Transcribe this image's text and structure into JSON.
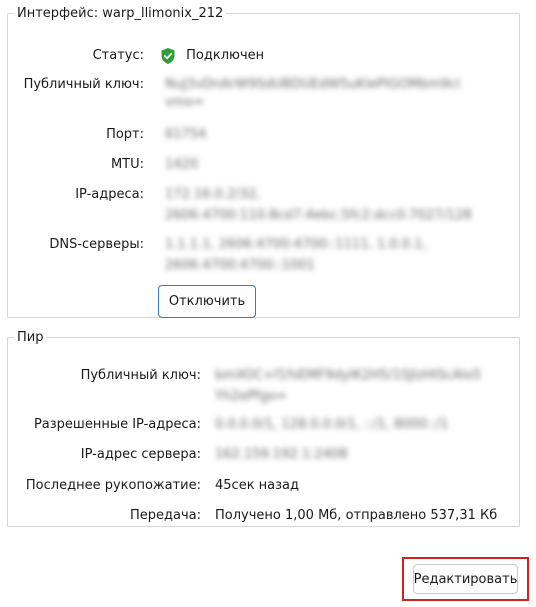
{
  "interface": {
    "legend": "Интерфейс: warp_llimonix_212",
    "status_label": "Статус:",
    "status_value": "Подключен",
    "status_icon": "shield-check-icon",
    "status_color": "#2e9d3a",
    "pubkey_label": "Публичный ключ:",
    "pubkey_value": "NuJ3vDnArW9SdUBDUEdW5uKlePIGOMbm9clvmo=",
    "port_label": "Порт:",
    "port_value": "61754",
    "mtu_label": "MTU:",
    "mtu_value": "1420",
    "ip_label": "IP-адреса:",
    "ip_value_1": "172.16.0.2/32,",
    "ip_value_2": "2606:4700:110:8cd7:4ebc:5fc2:dcc0:7027/128",
    "dns_label": "DNS-серверы:",
    "dns_value_1": "1.1.1.1, 2606:4700:4700::1111, 1.0.0.1,",
    "dns_value_2": "2606:4700:4700::1001",
    "disconnect_label": "Отключить"
  },
  "peer": {
    "legend": "Пир",
    "pubkey_label": "Публичный ключ:",
    "pubkey_value_1": "bmXOC+f1fsEMF9dyIK2H5/1SJIzHIScAlo5",
    "pubkey_value_2": "Yh2ePfgo=",
    "allowed_label": "Разрешенные IP-адреса:",
    "allowed_value": "0.0.0.0/1, 128.0.0.0/1, ::/1, 8000::/1",
    "endpoint_label": "IP-адрес сервера:",
    "endpoint_value": "162.159.192.1:2408",
    "handshake_label": "Последнее рукопожатие:",
    "handshake_value": "45сек назад",
    "transfer_label": "Передача:",
    "transfer_value": "Получено 1,00 Мб, отправлено 537,31 Кб"
  },
  "footer": {
    "edit_label": "Редактировать"
  }
}
